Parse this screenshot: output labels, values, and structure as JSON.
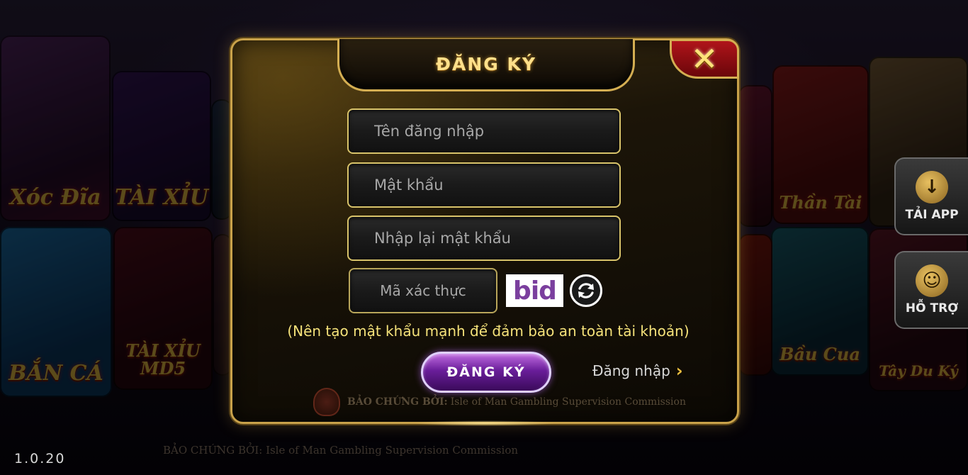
{
  "dialog": {
    "title": "ĐĂNG KÝ",
    "close_label": "✕",
    "username_placeholder": "Tên đăng nhập",
    "password_placeholder": "Mật khẩu",
    "repassword_placeholder": "Nhập lại mật khẩu",
    "captcha_placeholder": "Mã xác thực",
    "captcha_text": "bid",
    "hint": "(Nên tạo mật khẩu mạnh để đảm bảo an toàn tài khoản)",
    "register_label": "ĐĂNG KÝ",
    "login_label": "Đăng nhập",
    "login_chevron": "›",
    "cert_label": "BẢO CHỨNG BỞI:",
    "cert_text": "Isle of Man Gambling Supervision Commission"
  },
  "lobby": {
    "games": [
      {
        "label": "Xóc Đĩa"
      },
      {
        "label": "TÀI XỈU"
      },
      {
        "label": "BẮN CÁ"
      },
      {
        "label": "TÀI XỈU MD5"
      },
      {
        "label": "Thần Tài"
      },
      {
        "label": "Bầu Cua"
      },
      {
        "label": "Tây Du Ký"
      }
    ],
    "download_label": "TẢI APP",
    "support_label": "HỖ TRỢ",
    "version": "1.0.20",
    "bottom_cert": "BẢO CHỨNG BỞI: Isle of Man Gambling Supervision Commission"
  },
  "colors": {
    "gold": "#d4ae52",
    "accent_purple": "#6a1e9a",
    "hint_yellow": "#f5e27a",
    "close_red": "#b0141a"
  }
}
